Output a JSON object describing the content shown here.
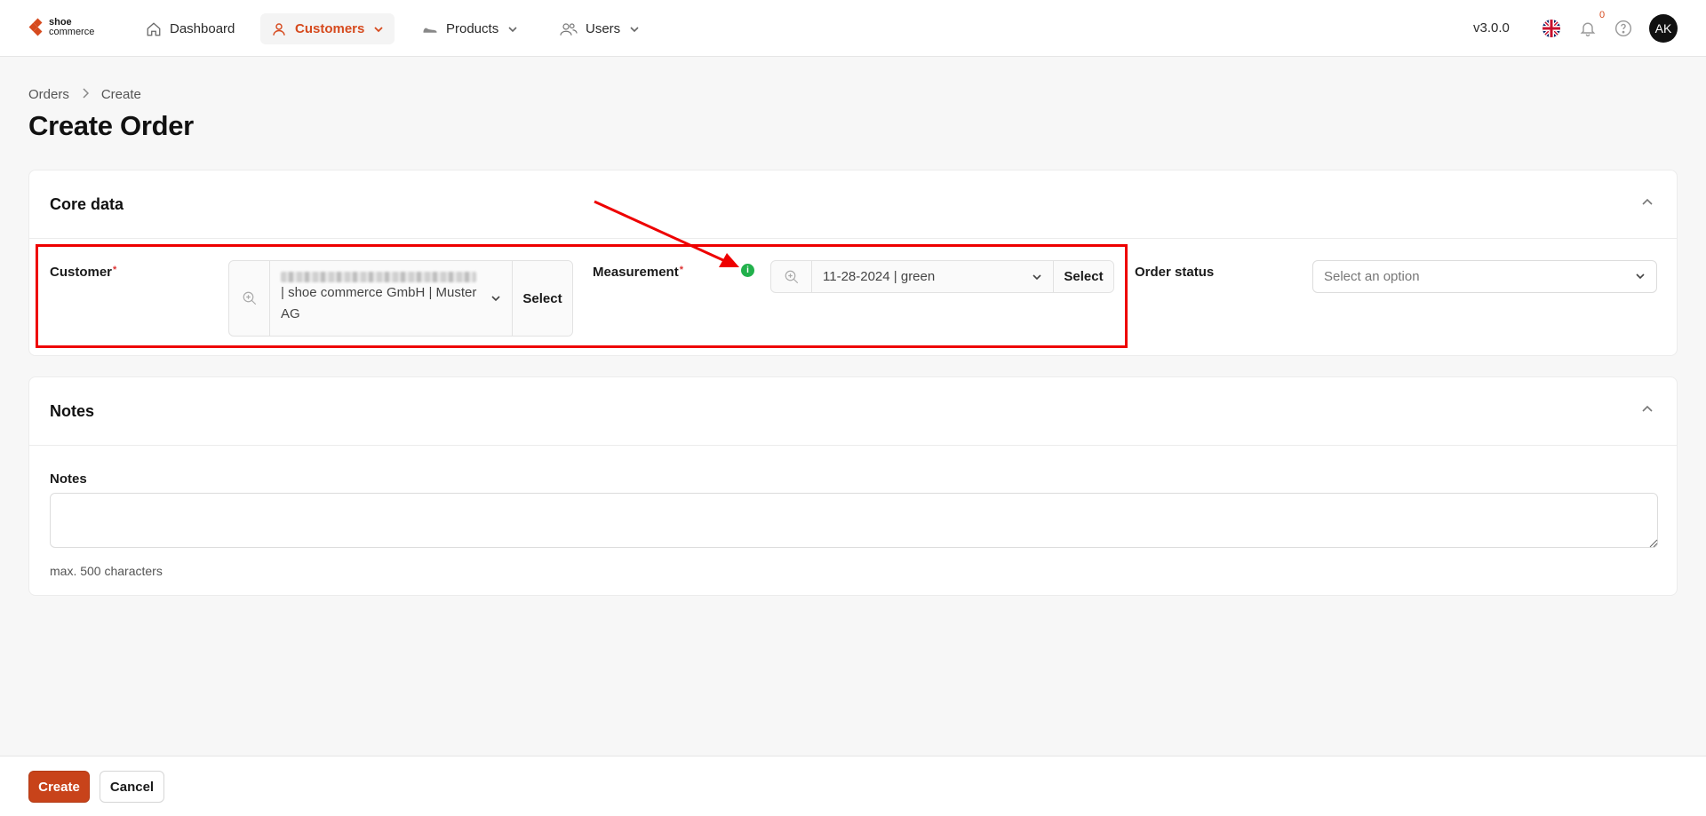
{
  "brand": {
    "line1": "shoe",
    "line2": "commerce"
  },
  "nav": {
    "dashboard": "Dashboard",
    "customers": "Customers",
    "products": "Products",
    "users": "Users"
  },
  "header": {
    "version": "v3.0.0",
    "notification_count": "0",
    "avatar_initials": "AK"
  },
  "breadcrumb": {
    "parent": "Orders",
    "current": "Create"
  },
  "page_title": "Create Order",
  "core_data": {
    "title": "Core data",
    "customer": {
      "label": "Customer",
      "value_line2": "| shoe commerce GmbH | Muster",
      "value_line3": "AG",
      "select_label": "Select"
    },
    "measurement": {
      "label": "Measurement",
      "info": "i",
      "value": "11-28-2024 | green",
      "select_label": "Select"
    },
    "order_status": {
      "label": "Order status",
      "placeholder": "Select an option"
    },
    "required_mark": "*"
  },
  "notes": {
    "title": "Notes",
    "field_label": "Notes",
    "value": "",
    "hint": "max. 500 characters"
  },
  "footer": {
    "create": "Create",
    "cancel": "Cancel"
  },
  "colors": {
    "accent": "#d64a1e",
    "annotation": "#e00000",
    "info": "#22b14c"
  }
}
